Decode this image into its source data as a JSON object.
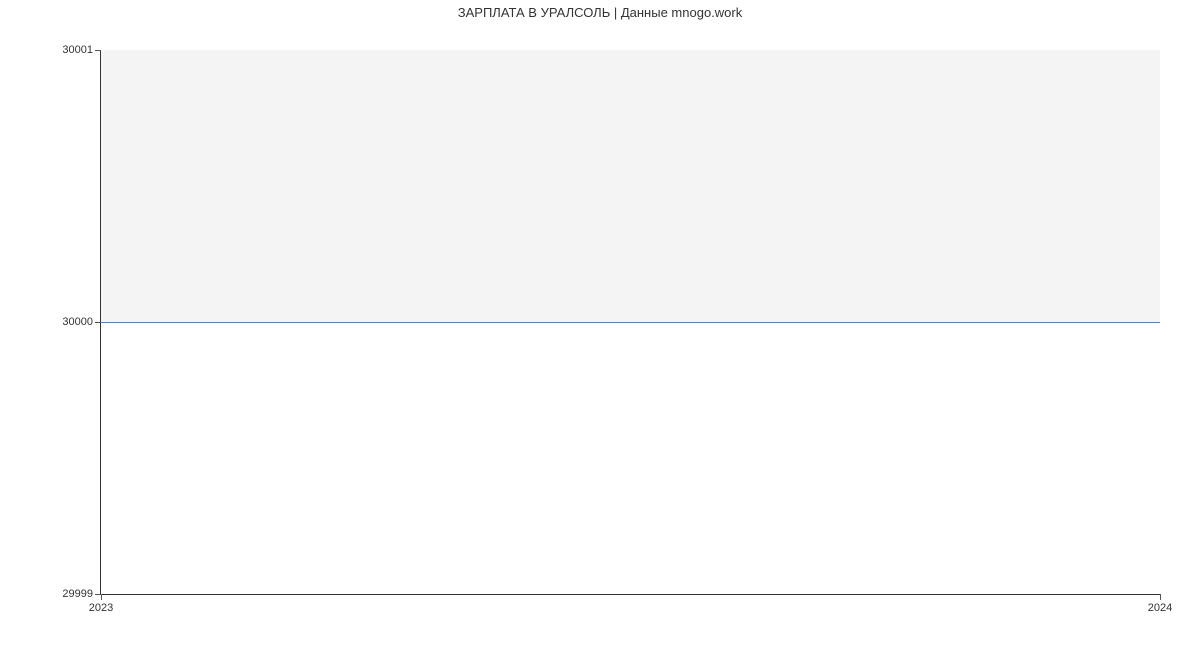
{
  "chart_data": {
    "type": "line",
    "title": "ЗАРПЛАТА В УРАЛСОЛЬ | Данные mnogo.work",
    "xlabel": "",
    "ylabel": "",
    "x": [
      2023,
      2024
    ],
    "values": [
      30000,
      30000
    ],
    "ylim": [
      29999,
      30001
    ],
    "xlim": [
      2023,
      2024
    ],
    "y_ticks": [
      29999,
      30000,
      30001
    ],
    "x_ticks": [
      2023,
      2024
    ]
  }
}
